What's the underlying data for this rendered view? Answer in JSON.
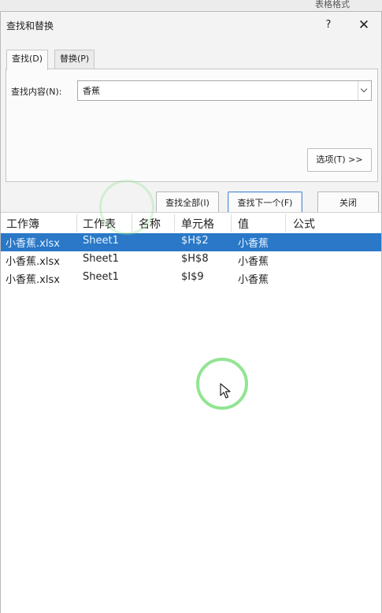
{
  "background": {
    "strip_items": [
      "表格格式",
      "表格格式"
    ]
  },
  "dialog": {
    "title": "查找和替换",
    "help_label": "?",
    "close_label": "✕",
    "tabs": [
      {
        "label": "查找(D)",
        "active": true
      },
      {
        "label": "替换(P)",
        "active": false
      }
    ],
    "find_label": "查找内容(N):",
    "find_value": "香蕉",
    "options_label": "选项(T) >>",
    "buttons": {
      "find_all": "查找全部(I)",
      "find_next": "查找下一个(F)",
      "close": "关闭"
    }
  },
  "results": {
    "columns": [
      "工作簿",
      "工作表",
      "名称",
      "单元格",
      "值",
      "公式"
    ],
    "rows": [
      {
        "workbook": "小香蕉.xlsx",
        "sheet": "Sheet1",
        "name": "",
        "cell": "$H$2",
        "value": "小香蕉",
        "formula": "",
        "selected": true
      },
      {
        "workbook": "小香蕉.xlsx",
        "sheet": "Sheet1",
        "name": "",
        "cell": "$H$8",
        "value": "小香蕉",
        "formula": "",
        "selected": false
      },
      {
        "workbook": "小香蕉.xlsx",
        "sheet": "Sheet1",
        "name": "",
        "cell": "$I$9",
        "value": "小香蕉",
        "formula": "",
        "selected": false
      }
    ]
  },
  "colors": {
    "selection": "#2a78c7",
    "primary_border": "#5b8fd6",
    "cursor_ring": "#6edc6e"
  },
  "icons": [
    "dropdown-chevron-icon",
    "mouse-pointer-icon",
    "click-highlight-ring"
  ]
}
